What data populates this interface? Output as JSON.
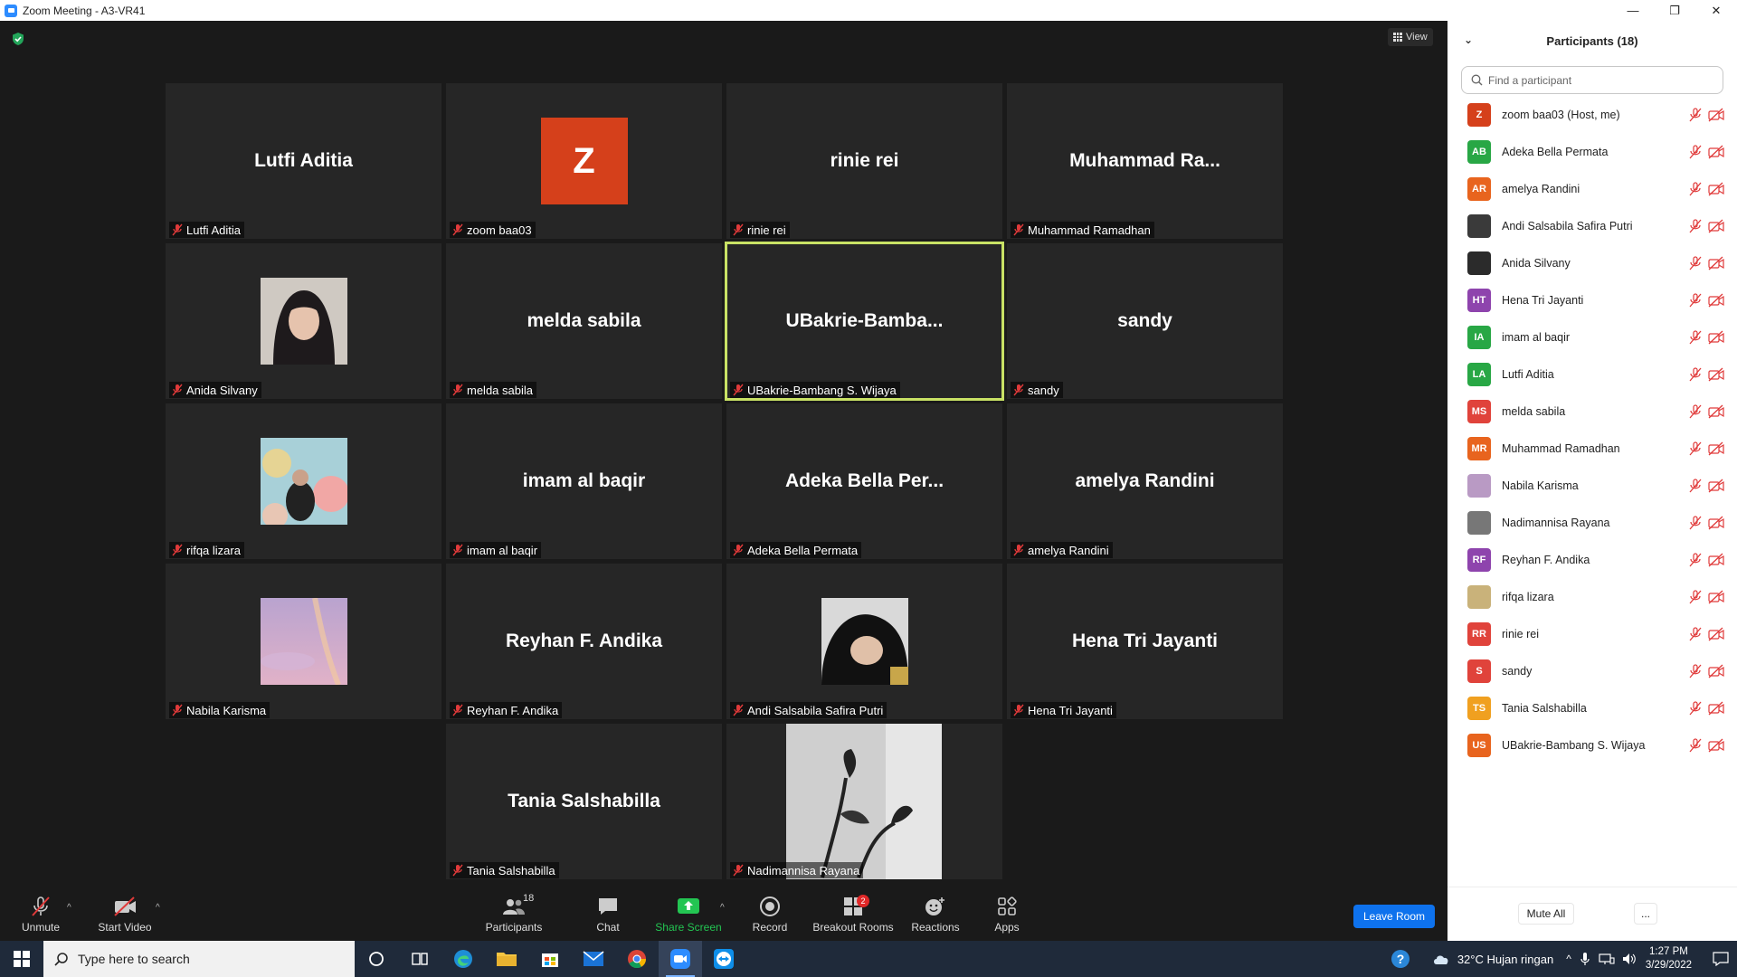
{
  "window": {
    "title": "Zoom Meeting - A3-VR41"
  },
  "view_button": "View",
  "tiles": [
    {
      "big": "Lutfi Aditia",
      "label": "Lutfi Aditia"
    },
    {
      "avatar": "Z",
      "label": "zoom baa03"
    },
    {
      "big": "rinie rei",
      "label": "rinie rei"
    },
    {
      "big": "Muhammad  Ra...",
      "label": "Muhammad Ramadhan"
    },
    {
      "photo": "anida",
      "label": "Anida Silvany"
    },
    {
      "big": "melda sabila",
      "label": "melda sabila"
    },
    {
      "big": "UBakrie-Bamba...",
      "label": "UBakrie-Bambang S. Wijaya"
    },
    {
      "big": "sandy",
      "label": "sandy"
    },
    {
      "photo": "rifqa",
      "label": "rifqa lizara"
    },
    {
      "big": "imam al baqir",
      "label": "imam al baqir"
    },
    {
      "big": "Adeka Bella Per...",
      "label": "Adeka Bella Permata"
    },
    {
      "big": "amelya Randini",
      "label": "amelya Randini"
    },
    {
      "photo": "nabila",
      "label": "Nabila Karisma"
    },
    {
      "big": "Reyhan F. Andika",
      "label": "Reyhan F. Andika"
    },
    {
      "photo": "andi",
      "label": "Andi Salsabila Safira Putri"
    },
    {
      "big": "Hena Tri Jayanti",
      "label": "Hena Tri Jayanti"
    },
    {
      "big": "Tania Salshabilla",
      "label": "Tania Salshabilla"
    },
    {
      "photo": "nadim",
      "label": "Nadimannisa Rayana"
    }
  ],
  "toolbar": {
    "unmute": "Unmute",
    "start_video": "Start Video",
    "participants": "Participants",
    "participants_count": "18",
    "chat": "Chat",
    "share_screen": "Share Screen",
    "record": "Record",
    "breakout_rooms": "Breakout Rooms",
    "breakout_badge": "2",
    "reactions": "Reactions",
    "apps": "Apps",
    "leave_room": "Leave Room",
    "caret": "^"
  },
  "panel": {
    "title": "Participants (18)",
    "search_placeholder": "Find a participant",
    "mute_all": "Mute All",
    "more": "...",
    "participants": [
      {
        "initials": "Z",
        "name": "zoom baa03 (Host, me)",
        "color": "#d5401b"
      },
      {
        "initials": "AB",
        "name": "Adeka Bella Permata",
        "color": "#28a745"
      },
      {
        "initials": "AR",
        "name": "amelya Randini",
        "color": "#e8641e"
      },
      {
        "initials": "",
        "name": "Andi Salsabila Safira Putri",
        "color": "#3a3a3a",
        "photo": true
      },
      {
        "initials": "",
        "name": "Anida Silvany",
        "color": "#2b2b2b",
        "photo": true
      },
      {
        "initials": "HT",
        "name": "Hena Tri Jayanti",
        "color": "#8e44ad"
      },
      {
        "initials": "IA",
        "name": "imam al baqir",
        "color": "#28a745"
      },
      {
        "initials": "LA",
        "name": "Lutfi Aditia",
        "color": "#28a745"
      },
      {
        "initials": "MS",
        "name": "melda sabila",
        "color": "#e0433b"
      },
      {
        "initials": "MR",
        "name": "Muhammad Ramadhan",
        "color": "#e8641e"
      },
      {
        "initials": "",
        "name": "Nabila Karisma",
        "color": "#b99ac4",
        "photo": true
      },
      {
        "initials": "",
        "name": "Nadimannisa Rayana",
        "color": "#777777",
        "photo": true
      },
      {
        "initials": "RF",
        "name": "Reyhan F. Andika",
        "color": "#8e44ad"
      },
      {
        "initials": "",
        "name": "rifqa lizara",
        "color": "#c9b27a",
        "photo": true
      },
      {
        "initials": "RR",
        "name": "rinie rei",
        "color": "#e0433b"
      },
      {
        "initials": "S",
        "name": "sandy",
        "color": "#e0433b"
      },
      {
        "initials": "TS",
        "name": "Tania Salshabilla",
        "color": "#f0a020"
      },
      {
        "initials": "US",
        "name": "UBakrie-Bambang S. Wijaya",
        "color": "#e8641e"
      }
    ]
  },
  "taskbar": {
    "search_placeholder": "Type here to search",
    "weather": "32°C  Hujan ringan",
    "time": "1:27 PM",
    "date": "3/29/2022"
  }
}
